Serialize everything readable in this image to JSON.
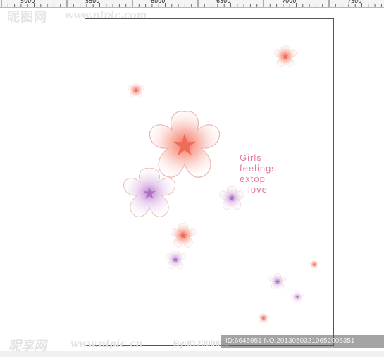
{
  "ruler": {
    "labels": [
      "5000",
      "5500",
      "6000",
      "6500",
      "7000",
      "7500"
    ]
  },
  "watermark": {
    "top_cn": "昵图网",
    "top_url": "www.nipic.com",
    "bottom_cn": "昵享网",
    "bottom_url": "www.nipic.cn",
    "by_text": "By:812200805",
    "id_text": "ID:6645951 NO:20130503210652005351"
  },
  "poem": {
    "line1": "Girls",
    "line2": "feelings",
    "line3": "extop",
    "line4": "love"
  },
  "colors": {
    "pink_text": "#e27aa0",
    "flower_salmon": "#f08c7c",
    "flower_violet": "#b07cc8",
    "frame_border": "#555555"
  }
}
